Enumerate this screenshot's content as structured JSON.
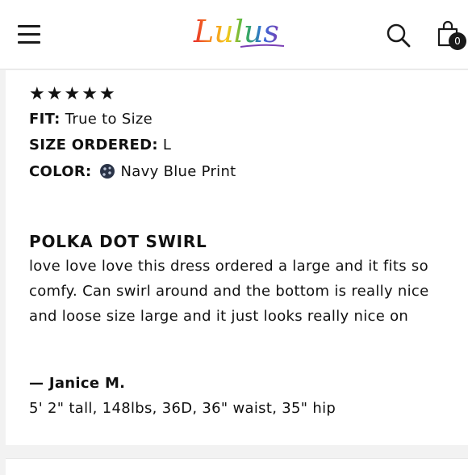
{
  "header": {
    "logo_text": "Lulus",
    "bag_count": "0"
  },
  "review": {
    "rating": 5,
    "stars": [
      "★",
      "★",
      "★",
      "★",
      "★"
    ],
    "fit_label": "FIT:",
    "fit_value": "True to Size",
    "size_label": "SIZE ORDERED:",
    "size_value": "L",
    "color_label": "COLOR:",
    "color_value": "Navy Blue Print",
    "swatch_color": "#2a3347",
    "title": "POLKA DOT SWIRL",
    "body": "love love love this dress ordered a large and it fits so comfy. Can swirl around and the bottom is really nice and loose size large and it just looks really nice on",
    "reviewer": "— Janice M.",
    "measurements": "5' 2\" tall, 148lbs, 36D, 36\" waist, 35\" hip"
  }
}
